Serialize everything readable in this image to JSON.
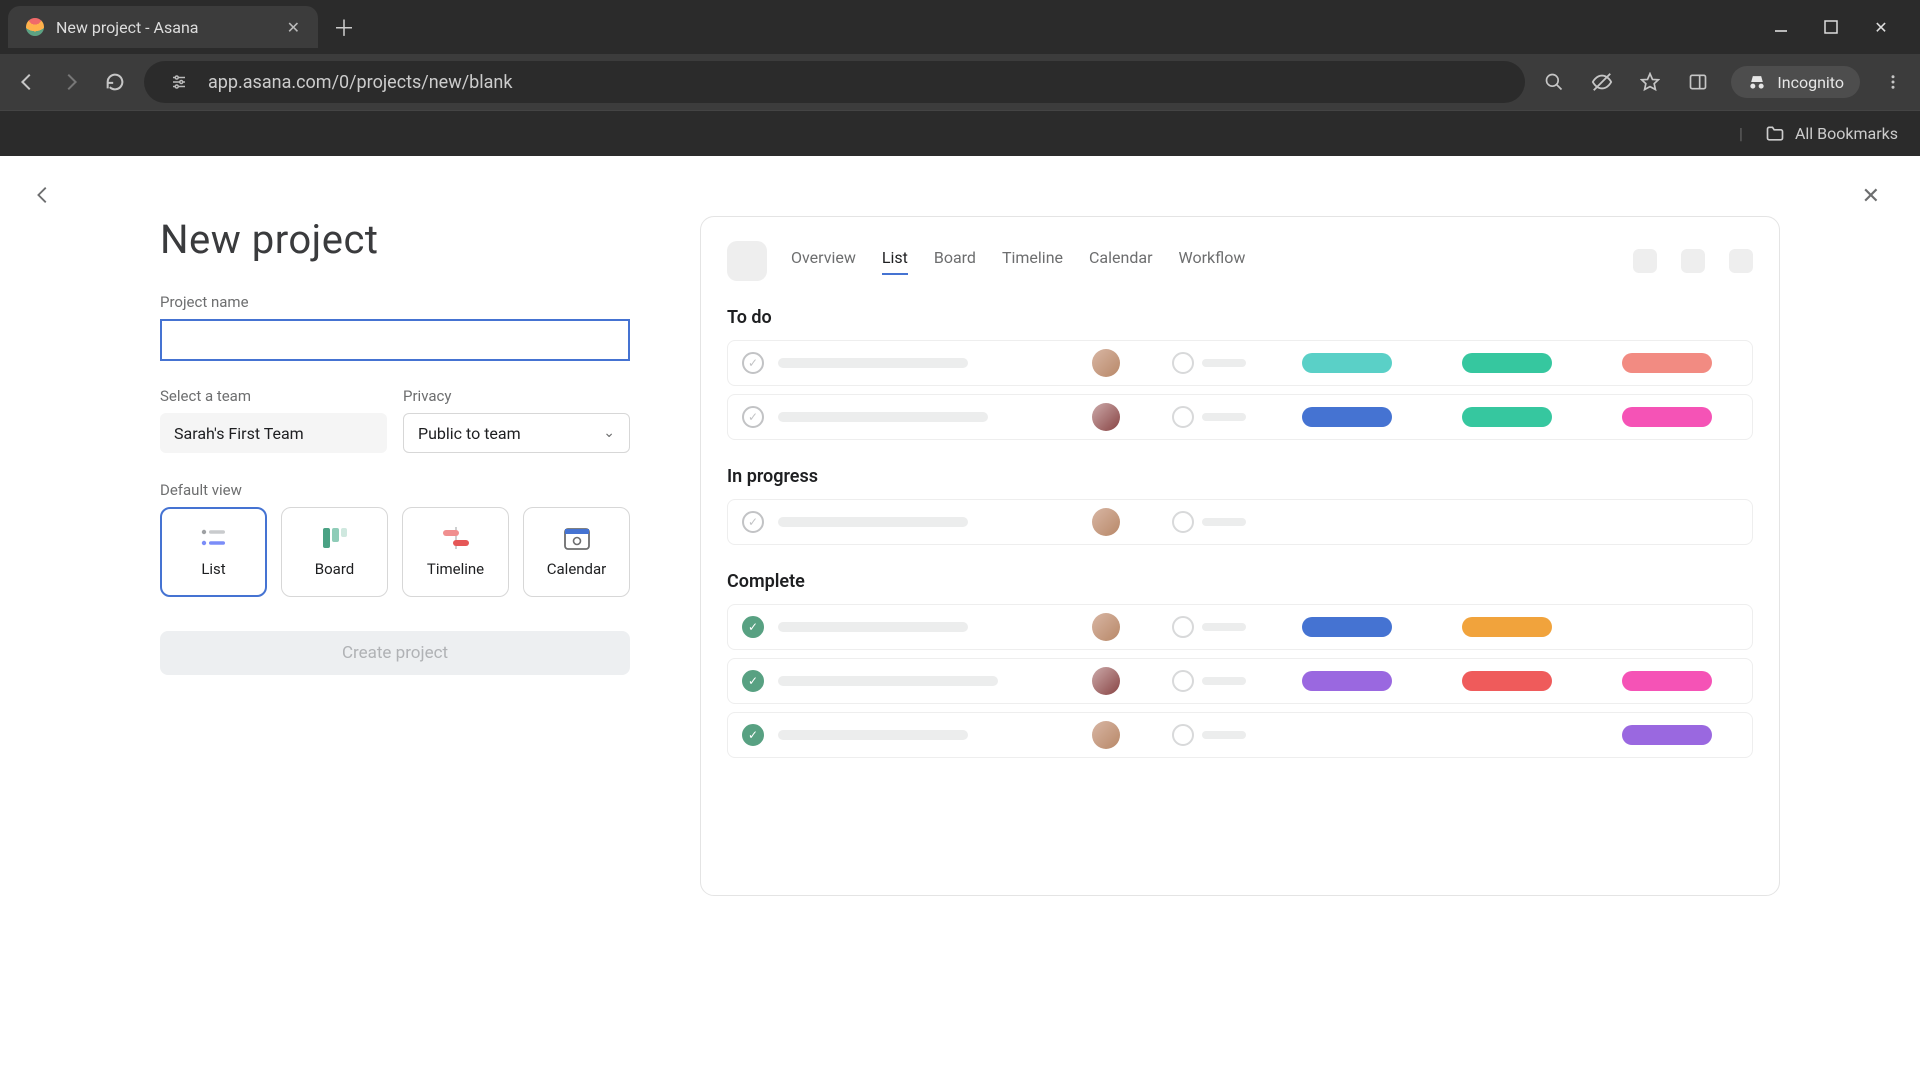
{
  "browser": {
    "tab_title": "New project - Asana",
    "url": "app.asana.com/0/projects/new/blank",
    "incognito_label": "Incognito",
    "bookmarks_label": "All Bookmarks"
  },
  "page": {
    "heading": "New project",
    "project_name_label": "Project name",
    "project_name_value": "",
    "team_label": "Select a team",
    "team_value": "Sarah's First Team",
    "privacy_label": "Privacy",
    "privacy_value": "Public to team",
    "default_view_label": "Default view",
    "views": {
      "list": "List",
      "board": "Board",
      "timeline": "Timeline",
      "calendar": "Calendar"
    },
    "create_button": "Create project"
  },
  "preview": {
    "tabs": {
      "overview": "Overview",
      "list": "List",
      "board": "Board",
      "timeline": "Timeline",
      "calendar": "Calendar",
      "workflow": "Workflow"
    },
    "sections": {
      "todo": "To do",
      "in_progress": "In progress",
      "complete": "Complete"
    }
  }
}
